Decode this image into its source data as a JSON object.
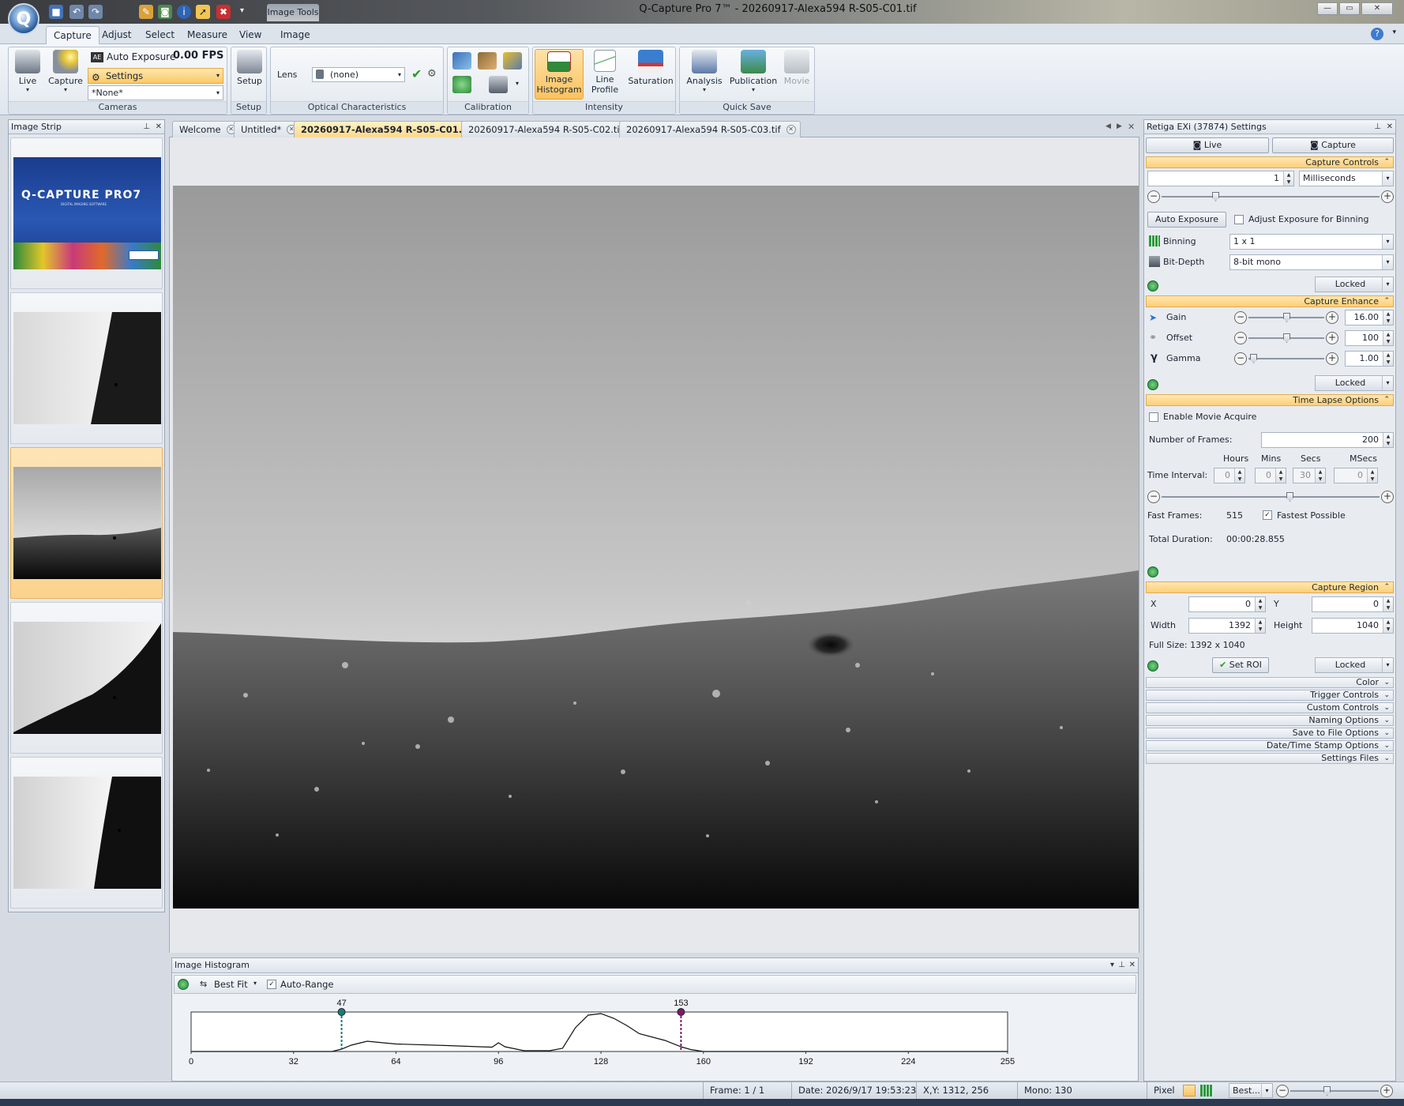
{
  "window": {
    "title": "Q-Capture Pro 7™ - 20260917-Alexa594 R-S05-C01.tif",
    "context_tab": "Image Tools"
  },
  "ribbon": {
    "tabs": [
      "Capture",
      "Adjust",
      "Select",
      "Measure",
      "View",
      "Image"
    ],
    "cameras": {
      "live": "Live",
      "capture": "Capture",
      "auto_exposure": "Auto Exposure",
      "fps": "0.00 FPS",
      "settings": "Settings",
      "preset": "*None*",
      "group": "Cameras"
    },
    "setup": {
      "button": "Setup",
      "group": "Setup"
    },
    "optical": {
      "lens_label": "Lens",
      "lens_value": "(none)",
      "group": "Optical Characteristics"
    },
    "calibration": {
      "group": "Calibration"
    },
    "intensity": {
      "histogram_l1": "Image",
      "histogram_l2": "Histogram",
      "line_l1": "Line",
      "line_l2": "Profile",
      "saturation": "Saturation",
      "group": "Intensity"
    },
    "quicksave": {
      "analysis": "Analysis",
      "publication": "Publication",
      "movie": "Movie",
      "group": "Quick Save"
    }
  },
  "strip": {
    "title": "Image Strip",
    "splash_title": "Q-CAPTURE PRO7",
    "splash_sub": "DIGITAL IMAGING SOFTWARE"
  },
  "doc_tabs": [
    "Welcome",
    "Untitled*",
    "20260917-Alexa594 R-S05-C01.tif",
    "20260917-Alexa594 R-S05-C02.tif",
    "20260917-Alexa594 R-S05-C03.tif"
  ],
  "histogram": {
    "title": "Image Histogram",
    "best_fit": "Best Fit",
    "auto_range": "Auto-Range",
    "low_marker": "47",
    "high_marker": "153",
    "ticks": [
      "0",
      "32",
      "64",
      "96",
      "128",
      "160",
      "192",
      "224",
      "255"
    ]
  },
  "settings": {
    "title": "Retiga EXi (37874) Settings",
    "live_tab": "Live",
    "capture_tab": "Capture",
    "capture_controls": {
      "header": "Capture Controls",
      "exposure": "1",
      "unit": "Milliseconds",
      "auto_exposure": "Auto Exposure",
      "adjust_binning": "Adjust Exposure for Binning",
      "binning_label": "Binning",
      "binning": "1 x 1",
      "bitdepth_label": "Bit-Depth",
      "bitdepth": "8-bit mono",
      "locked": "Locked"
    },
    "capture_enhance": {
      "header": "Capture Enhance",
      "gain_label": "Gain",
      "gain": "16.00",
      "offset_label": "Offset",
      "offset": "100",
      "gamma_label": "Gamma",
      "gamma": "1.00",
      "locked": "Locked"
    },
    "time_lapse": {
      "header": "Time Lapse Options",
      "enable": "Enable Movie Acquire",
      "frames_label": "Number of  Frames:",
      "frames": "200",
      "hours": "Hours",
      "mins": "Mins",
      "secs": "Secs",
      "msecs": "MSecs",
      "interval_label": "Time Interval:",
      "h": "0",
      "m": "0",
      "s": "30",
      "ms": "0",
      "fast_frames_label": "Fast Frames:",
      "fast_frames": "515",
      "fastest": "Fastest Possible",
      "total_label": "Total Duration:",
      "total": "00:00:28.855"
    },
    "capture_region": {
      "header": "Capture Region",
      "x_label": "X",
      "x": "0",
      "y_label": "Y",
      "y": "0",
      "width_label": "Width",
      "width": "1392",
      "height_label": "Height",
      "height": "1040",
      "full_size": "Full Size: 1392 x 1040",
      "set_roi": "Set ROI",
      "locked": "Locked"
    },
    "collapsed": [
      "Color",
      "Trigger Controls",
      "Custom Controls",
      "Naming Options",
      "Save to File Options",
      "Date/Time Stamp Options",
      "Settings Files"
    ]
  },
  "status": {
    "frame": "Frame: 1 / 1",
    "date": "Date: 2026/9/17 19:53:23",
    "xy": "X,Y: 1312,  256",
    "mono": "Mono:  130",
    "pixel": "Pixel",
    "zoom": "Best..."
  },
  "colors": {
    "accent_orange": "#fcd88a",
    "ribbon_blue": "#dfe6ee",
    "histogram_low_marker": "#1a7a7a",
    "histogram_high_marker": "#7a1a6e"
  },
  "chart_data": {
    "type": "line",
    "title": "",
    "x": [
      0,
      32,
      44,
      47,
      50,
      55,
      60,
      64,
      80,
      90,
      94,
      96,
      98,
      104,
      112,
      116,
      120,
      124,
      128,
      132,
      136,
      140,
      148,
      153,
      156,
      160,
      192,
      224,
      255
    ],
    "values": [
      0,
      0,
      0,
      6,
      16,
      26,
      22,
      19,
      15,
      12,
      11,
      22,
      12,
      2,
      2,
      8,
      60,
      92,
      96,
      84,
      66,
      45,
      28,
      12,
      5,
      0,
      0,
      0,
      0
    ],
    "xlim": [
      0,
      255
    ],
    "ticks": [
      0,
      32,
      64,
      96,
      128,
      160,
      192,
      224,
      255
    ],
    "markers": [
      47,
      153
    ]
  }
}
